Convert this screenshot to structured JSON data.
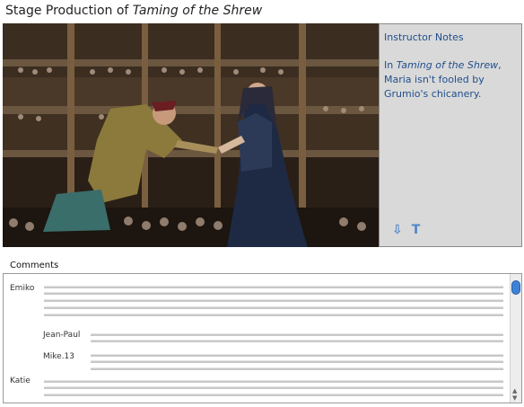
{
  "header": {
    "prefix": "Stage Production of ",
    "play_title": "Taming of the Shrew"
  },
  "video": {
    "description": "Costumed actors on the stage of a round theatre, a kneeling man in doublet taking a lady's hand before a packed audience"
  },
  "notes": {
    "title": "Instructor Notes",
    "body_pre": "In ",
    "body_title": "Taming of the Shrew",
    "body_post": ", Maria isn't fooled by Grumio's chicanery.",
    "download_glyph": "⇩",
    "text_glyph": "T"
  },
  "comments": {
    "label": "Comments",
    "authors": [
      "Emiko",
      "Jean-Paul",
      "Mike.13",
      "Katie"
    ]
  },
  "colors": {
    "accent": "#1f4e8c",
    "scroll_thumb": "#3d82d9",
    "panel": "#d9d9d9"
  }
}
